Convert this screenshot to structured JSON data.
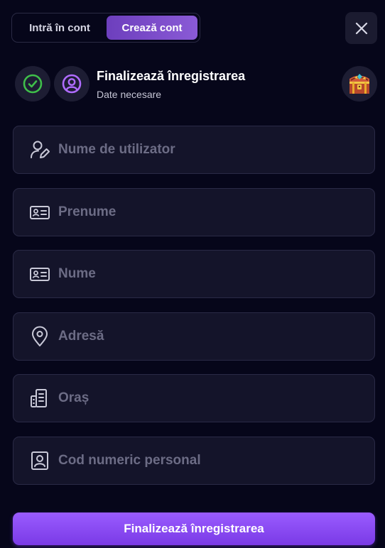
{
  "tabs": {
    "login": "Intră în cont",
    "register": "Crează cont"
  },
  "header": {
    "title": "Finalizează înregistrarea",
    "subtitle": "Date necesare"
  },
  "fields": [
    {
      "icon": "user-edit-icon",
      "placeholder": "Nume de utilizator",
      "value": ""
    },
    {
      "icon": "id-card-icon",
      "placeholder": "Prenume",
      "value": ""
    },
    {
      "icon": "id-card-icon",
      "placeholder": "Nume",
      "value": ""
    },
    {
      "icon": "location-pin-icon",
      "placeholder": "Adresă",
      "value": ""
    },
    {
      "icon": "building-icon",
      "placeholder": "Oraș",
      "value": ""
    },
    {
      "icon": "portrait-id-icon",
      "placeholder": "Cod numeric personal",
      "value": ""
    }
  ],
  "submit_label": "Finalizează înregistrarea",
  "colors": {
    "background": "#06061a",
    "accent": "#8a4df0",
    "step_done": "#3fbf4a",
    "step_active": "#b06cff"
  }
}
